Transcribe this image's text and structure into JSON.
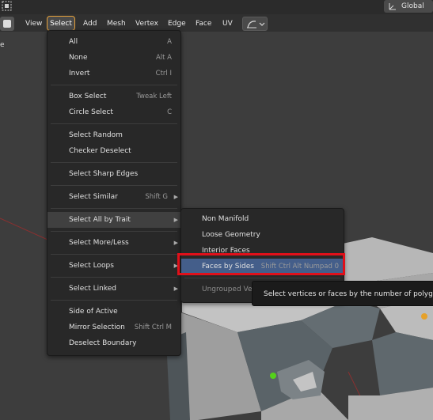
{
  "header": {
    "items": [
      {
        "label": "View"
      },
      {
        "label": "Select"
      },
      {
        "label": "Add"
      },
      {
        "label": "Mesh"
      },
      {
        "label": "Vertex"
      },
      {
        "label": "Edge"
      },
      {
        "label": "Face"
      },
      {
        "label": "UV"
      }
    ],
    "transform_orientation": "Global"
  },
  "side_letter": "e",
  "select_menu": {
    "items": [
      {
        "label": "All",
        "shortcut": "A"
      },
      {
        "label": "None",
        "shortcut": "Alt A"
      },
      {
        "label": "Invert",
        "shortcut": "Ctrl I"
      },
      {
        "label": "Box Select",
        "shortcut": "Tweak Left"
      },
      {
        "label": "Circle Select",
        "shortcut": "C"
      },
      {
        "label": "Select Random",
        "shortcut": ""
      },
      {
        "label": "Checker Deselect",
        "shortcut": ""
      },
      {
        "label": "Select Sharp Edges",
        "shortcut": ""
      },
      {
        "label": "Select Similar",
        "shortcut": "Shift G"
      },
      {
        "label": "Select All by Trait",
        "shortcut": ""
      },
      {
        "label": "Select More/Less",
        "shortcut": ""
      },
      {
        "label": "Select Loops",
        "shortcut": ""
      },
      {
        "label": "Select Linked",
        "shortcut": ""
      },
      {
        "label": "Side of Active",
        "shortcut": ""
      },
      {
        "label": "Mirror Selection",
        "shortcut": "Shift Ctrl M"
      },
      {
        "label": "Deselect Boundary",
        "shortcut": ""
      }
    ]
  },
  "trait_menu": {
    "items": [
      {
        "label": "Non Manifold",
        "shortcut": ""
      },
      {
        "label": "Loose Geometry",
        "shortcut": ""
      },
      {
        "label": "Interior Faces",
        "shortcut": ""
      },
      {
        "label": "Faces by Sides",
        "shortcut": "Shift Ctrl Alt Numpad 0"
      },
      {
        "label": "Ungrouped Verts",
        "shortcut": ""
      }
    ]
  },
  "tooltip": {
    "text": "Select vertices or faces by the number of polygon sides"
  },
  "colors": {
    "highlight": "#445e8a",
    "menu_bg": "#282828",
    "annotation_box": "#e0101a",
    "select_outline": "#e6a13a"
  }
}
